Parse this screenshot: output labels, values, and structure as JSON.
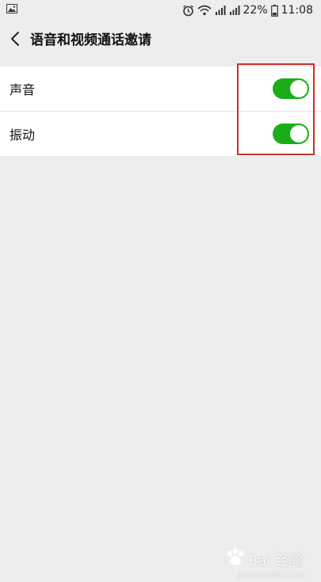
{
  "status_bar": {
    "battery_percent": "22%",
    "time": "11:08",
    "icons": [
      "image-icon",
      "alarm-icon",
      "wifi-icon",
      "signal-icon",
      "battery-icon"
    ]
  },
  "header": {
    "title": "语音和视频通话邀请",
    "back_icon": "chevron-left-icon"
  },
  "settings": [
    {
      "label": "声音",
      "enabled": true
    },
    {
      "label": "振动",
      "enabled": true
    }
  ],
  "colors": {
    "toggle_on": "#1aad19",
    "highlight": "#c9302c",
    "background": "#ededed"
  },
  "watermark": {
    "text": "Bai 经验",
    "url": "jingyan.baidu.com"
  }
}
